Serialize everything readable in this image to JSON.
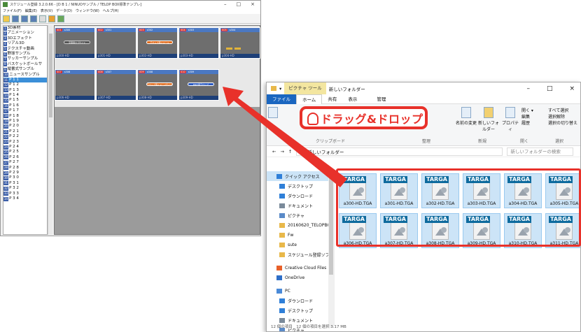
{
  "app": {
    "title": "スケジュール登録 3.2.0.66 - [D B 1 / NINUOサンプル / TELOP BOX標準テンプレ]",
    "menu": [
      "ファイル(F)",
      "編集(E)",
      "表示(V)",
      "データ(D)",
      "ウィンドウ(W)",
      "ヘルプ(H)"
    ],
    "window_controls": [
      "–",
      "□",
      "×"
    ],
    "tree": [
      {
        "n": "1",
        "label": "3D素材"
      },
      {
        "n": "2",
        "label": "アニメーション"
      },
      {
        "n": "3",
        "label": "3Dエフェクト"
      },
      {
        "n": "4",
        "label": "リアル3D"
      },
      {
        "n": "5",
        "label": "テクスチャ動画"
      },
      {
        "n": "6",
        "label": "野球サンプル"
      },
      {
        "n": "7",
        "label": "サッカーサンプル"
      },
      {
        "n": "8",
        "label": "バスケットボールサ"
      },
      {
        "n": "9",
        "label": "縦書式サンプル"
      },
      {
        "n": "10",
        "label": "ニュースサンプル"
      },
      {
        "n": "11",
        "label": "P 1 1"
      },
      {
        "n": "12",
        "label": "P 1 2"
      },
      {
        "n": "13",
        "label": "P 1 3"
      },
      {
        "n": "14",
        "label": "P 1 4"
      },
      {
        "n": "15",
        "label": "P 1 5"
      },
      {
        "n": "16",
        "label": "P 1 6"
      },
      {
        "n": "17",
        "label": "P 1 7"
      },
      {
        "n": "18",
        "label": "P 1 8"
      },
      {
        "n": "19",
        "label": "P 1 9"
      },
      {
        "n": "20",
        "label": "P 2 0"
      },
      {
        "n": "21",
        "label": "P 2 1"
      },
      {
        "n": "22",
        "label": "P 2 2"
      },
      {
        "n": "23",
        "label": "P 2 3"
      },
      {
        "n": "24",
        "label": "P 2 4"
      },
      {
        "n": "25",
        "label": "P 2 5"
      },
      {
        "n": "26",
        "label": "P 2 6"
      },
      {
        "n": "27",
        "label": "P 2 7"
      },
      {
        "n": "28",
        "label": "P 2 8"
      },
      {
        "n": "29",
        "label": "P 2 9"
      },
      {
        "n": "30",
        "label": "P 3 0"
      },
      {
        "n": "31",
        "label": "P 3 1"
      },
      {
        "n": "32",
        "label": "P 3 2"
      },
      {
        "n": "33",
        "label": "P 3 3"
      },
      {
        "n": "34",
        "label": "P 3 4"
      }
    ],
    "selected_index": 10,
    "cells": [
      {
        "num": "001",
        "id": "s300",
        "lbl": "p300-HD",
        "tag": "字幕用ロゴサイド"
      },
      {
        "num": "002",
        "id": "s301",
        "lbl": "p301-HD",
        "tag": ""
      },
      {
        "num": "003",
        "id": "s302",
        "lbl": "p302-HD",
        "tag": "テロップ用イメージ"
      },
      {
        "num": "004",
        "id": "s303",
        "lbl": "p303-HD",
        "tag": ""
      },
      {
        "num": "005",
        "id": "s304",
        "lbl": "p304-HD",
        "tag": ""
      },
      {
        "num": "006",
        "id": "s305",
        "lbl": "p305-HD",
        "tag": ""
      },
      {
        "num": "007",
        "id": "s306",
        "lbl": "p306-HD",
        "tag": ""
      },
      {
        "num": "008",
        "id": "s307",
        "lbl": "p307-HD",
        "tag": ""
      },
      {
        "num": "009",
        "id": "s308",
        "lbl": "p308-HD",
        "tag": "テロップ用イメージサイド"
      },
      {
        "num": "010",
        "id": "s309",
        "lbl": "p309-HD",
        "tag": "EDIT用テロップ"
      }
    ]
  },
  "explorer": {
    "title": "新しいフォルダー",
    "context_tab": "ピクチャ ツール",
    "window_controls": [
      "–",
      "□",
      "×"
    ],
    "tabs": [
      "ファイル",
      "ホーム",
      "共有",
      "表示",
      "管理"
    ],
    "ribbon": {
      "groups": [
        "クリップボード",
        "整理",
        "新規",
        "開く",
        "選択"
      ],
      "buttons": [
        "名前の変更",
        "新しいフォルダー",
        "プロパティ"
      ],
      "open_items": [
        "開く ▾",
        "編集",
        "履歴"
      ],
      "select_items": [
        "すべて選択",
        "選択解除",
        "選択の切り替え"
      ]
    },
    "address": "新しいフォルダー",
    "search_placeholder": "新しいフォルダーの検索",
    "nav": [
      {
        "label": "クイック アクセス",
        "icon": "star-icon",
        "sub": false
      },
      {
        "label": "デスクトップ",
        "icon": "desktop-icon",
        "sub": true
      },
      {
        "label": "ダウンロード",
        "icon": "download-icon",
        "sub": true
      },
      {
        "label": "ドキュメント",
        "icon": "document-icon",
        "sub": true
      },
      {
        "label": "ピクチャ",
        "icon": "pictures-icon",
        "sub": true
      },
      {
        "label": "20160620_TELOPBOX",
        "icon": "folder-icon",
        "sub": true
      },
      {
        "label": "Fw",
        "icon": "folder-icon",
        "sub": true
      },
      {
        "label": "sute",
        "icon": "folder-icon",
        "sub": true
      },
      {
        "label": "スケジュール登録ソフト",
        "icon": "folder-icon",
        "sub": true
      },
      {
        "label": "Creative Cloud Files",
        "icon": "creative-cloud-icon",
        "sub": false
      },
      {
        "label": "OneDrive",
        "icon": "onedrive-icon",
        "sub": false
      },
      {
        "label": "PC",
        "icon": "pc-icon",
        "sub": false
      },
      {
        "label": "ダウンロード",
        "icon": "download-icon",
        "sub": true
      },
      {
        "label": "デスクトップ",
        "icon": "desktop-icon",
        "sub": true
      },
      {
        "label": "ドキュメント",
        "icon": "document-icon",
        "sub": true
      },
      {
        "label": "ピクチャ",
        "icon": "pictures-icon",
        "sub": true
      },
      {
        "label": "ビデオ",
        "icon": "video-icon",
        "sub": true
      }
    ],
    "files": [
      "a300-HD.TGA",
      "a301-HD.TGA",
      "a302-HD.TGA",
      "a303-HD.TGA",
      "a304-HD.TGA",
      "a305-HD.TGA",
      "a306-HD.TGA",
      "a307-HD.TGA",
      "a308-HD.TGA",
      "a309-HD.TGA",
      "a310-HD.TGA",
      "a311-HD.TGA"
    ],
    "file_badge": "TARGA",
    "status": "12 個の項目　12 個の項目を選択 3.17 MB"
  },
  "callout": {
    "text": "ドラッグ&ドロップ"
  },
  "colors": {
    "accent_red": "#e8312a",
    "selection": "#cce4f7",
    "file_tab": "#1a66c0"
  }
}
